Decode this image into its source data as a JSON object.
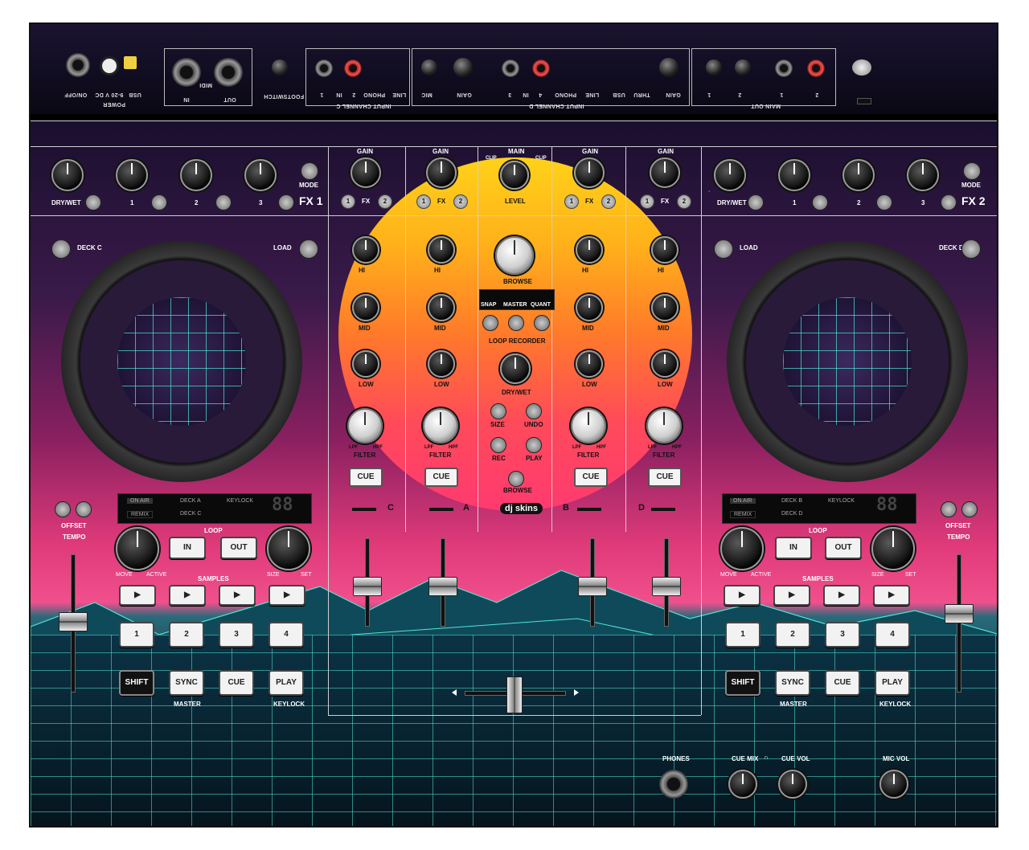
{
  "rear_panel": {
    "power": {
      "group": "POWER",
      "labels": [
        "ON/OFF",
        "9-20 V DC",
        "USB"
      ]
    },
    "midi": {
      "group": "MIDI",
      "labels": [
        "IN",
        "OUT"
      ]
    },
    "footswitch": "FOOTSWITCH",
    "input_c": {
      "group": "INPUT CHANNEL C",
      "labels": [
        "1",
        "IN",
        "2",
        "PHONO",
        "LINE"
      ]
    },
    "input_d": {
      "group": "INPUT CHANNEL D",
      "labels": [
        "MIC",
        "GAIN",
        "3",
        "IN",
        "4",
        "PHONO",
        "LINE",
        "USB",
        "THRU",
        "GAIN"
      ]
    },
    "main_out": {
      "group": "MAIN OUT",
      "labels": [
        "1",
        "2",
        "1",
        "2"
      ]
    }
  },
  "fx1": {
    "title": "FX 1",
    "knobs": [
      "DRY/WET",
      "1",
      "2",
      "3"
    ],
    "mode": "MODE"
  },
  "fx2": {
    "title": "FX 2",
    "knobs": [
      "DRY/WET",
      "1",
      "2",
      "3"
    ],
    "mode": "MODE"
  },
  "mixer": {
    "gain": "GAIN",
    "fx": "FX",
    "fx_buttons": [
      "1",
      "2"
    ],
    "main": {
      "label": "MAIN",
      "clip": "CLIP",
      "level": "LEVEL"
    },
    "eq": [
      "HI",
      "MID",
      "LOW"
    ],
    "filter": {
      "label": "FILTER",
      "lpf": "LPF",
      "hpf": "HPF"
    },
    "cue": "CUE",
    "channels": [
      "C",
      "A",
      "B",
      "D"
    ],
    "browse": "BROWSE",
    "modes": [
      "SNAP",
      "MASTER",
      "QUANT"
    ],
    "loop_recorder": "LOOP RECORDER",
    "dry_wet": "DRY/WET",
    "loop_buttons": [
      "SIZE",
      "UNDO",
      "REC",
      "PLAY"
    ],
    "browse2": "BROWSE",
    "brand": "dj skins"
  },
  "deck_left": {
    "deck_name": "DECK C",
    "load": "LOAD",
    "display": {
      "on_air": "ON AIR",
      "remix": "REMIX",
      "deck_a": "DECK A",
      "deck_c": "DECK C",
      "keylock": "KEYLOCK",
      "digits": "88"
    },
    "offset": "OFFSET",
    "tempo": "TEMPO",
    "loop": {
      "label": "LOOP",
      "in": "IN",
      "out": "OUT",
      "move": "MOVE",
      "active": "ACTIVE",
      "size": "SIZE",
      "set": "SET"
    },
    "samples": "SAMPLES",
    "sample_pads": [
      "▶",
      "▶",
      "▶",
      "▶"
    ],
    "hotcues": [
      "1",
      "2",
      "3",
      "4"
    ],
    "transport": {
      "shift": "SHIFT",
      "sync": "SYNC",
      "cue": "CUE",
      "play": "PLAY",
      "master": "MASTER",
      "keylock": "KEYLOCK"
    }
  },
  "deck_right": {
    "deck_name": "DECK D",
    "load": "LOAD",
    "display": {
      "on_air": "ON AIR",
      "remix": "REMIX",
      "deck_a": "DECK B",
      "deck_c": "DECK D",
      "keylock": "KEYLOCK",
      "digits": "88"
    },
    "offset": "OFFSET",
    "tempo": "TEMPO",
    "loop": {
      "label": "LOOP",
      "in": "IN",
      "out": "OUT",
      "move": "MOVE",
      "active": "ACTIVE",
      "size": "SIZE",
      "set": "SET"
    },
    "samples": "SAMPLES",
    "sample_pads": [
      "▶",
      "▶",
      "▶",
      "▶"
    ],
    "hotcues": [
      "1",
      "2",
      "3",
      "4"
    ],
    "transport": {
      "shift": "SHIFT",
      "sync": "SYNC",
      "cue": "CUE",
      "play": "PLAY",
      "master": "MASTER",
      "keylock": "KEYLOCK"
    }
  },
  "front": {
    "phones": "PHONES",
    "cue_mix": "CUE MIX",
    "cue_vol": "CUE VOL",
    "mic_vol": "MIC VOL"
  },
  "colors": {
    "sun_top": "#ffd21a",
    "sun_bottom": "#ff3a70",
    "grid": "#50e6d2",
    "panel_line": "#cfcfcf"
  }
}
